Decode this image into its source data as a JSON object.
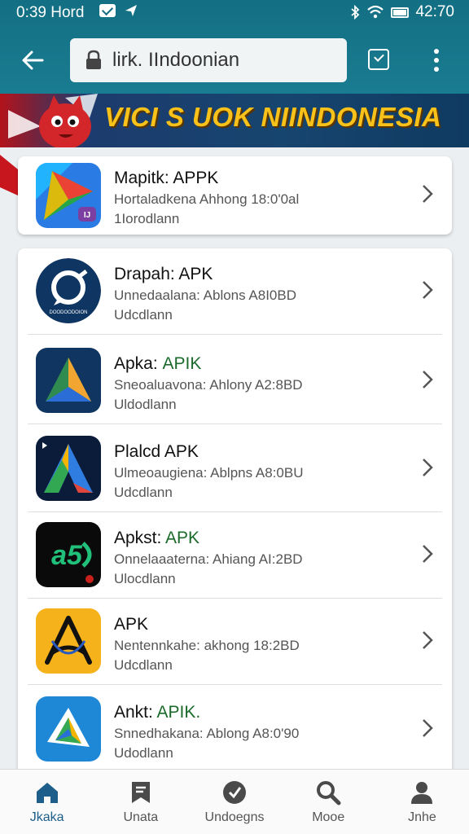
{
  "status_bar": {
    "time": "0:39 Hord",
    "clock": "42:70"
  },
  "browser": {
    "url": "lirk. IIndoonian"
  },
  "banner": {
    "text": "VICI S UOK NIINDONESIA"
  },
  "featured": {
    "title": "Mapitk: APPK",
    "subtitle": "Hortaladkena Ahhong 18:0'0al",
    "status": "1Iorodlann",
    "icon": "maps-triangle-icon"
  },
  "apps": [
    {
      "title": "Drapah: APK",
      "title_accent": "",
      "subtitle": "Unnedaalana: Ablons A8I0BD",
      "status": "Udcdlann",
      "icon": "chat-bubble-icon"
    },
    {
      "title": "Apkа: ",
      "title_accent": "APIK",
      "subtitle": "Sneoaluavona: Ahlony A2:8BD",
      "status": "Uldodlann",
      "icon": "triangle-a-icon"
    },
    {
      "title": "Plalcd APK",
      "title_accent": "",
      "subtitle": "Ulmeoaugiena: Ablpns A8:0BU",
      "status": "Udcdlann",
      "icon": "play-a-icon"
    },
    {
      "title": "Apkst: ",
      "title_accent": "APK",
      "subtitle": "Onnelaaaterna: Ahiang AI:2BD",
      "status": "Ulocdlann",
      "icon": "a5-logo-icon"
    },
    {
      "title": "APK",
      "title_accent": "",
      "subtitle": "Nentennkahe: akhong 18:2BD",
      "status": "Udcdlann",
      "icon": "compass-a-icon"
    },
    {
      "title": "Ankt: ",
      "title_accent": "APIK.",
      "subtitle": "Snnedhakana: Ablong A8:0'90",
      "status": "Udodlann",
      "icon": "paper-plane-icon"
    }
  ],
  "bottom_nav": [
    {
      "label": "Jkaka",
      "icon": "home-icon",
      "active": true
    },
    {
      "label": "Unata",
      "icon": "bookmark-icon",
      "active": false
    },
    {
      "label": "Undoegns",
      "icon": "shield-check-icon",
      "active": false
    },
    {
      "label": "Mooe",
      "icon": "search-icon",
      "active": false
    },
    {
      "label": "Jnhe",
      "icon": "profile-icon",
      "active": false
    }
  ],
  "colors": {
    "topbar": "#136f83",
    "banner_text": "#f8c21a",
    "accent_green": "#1b6a2b"
  }
}
